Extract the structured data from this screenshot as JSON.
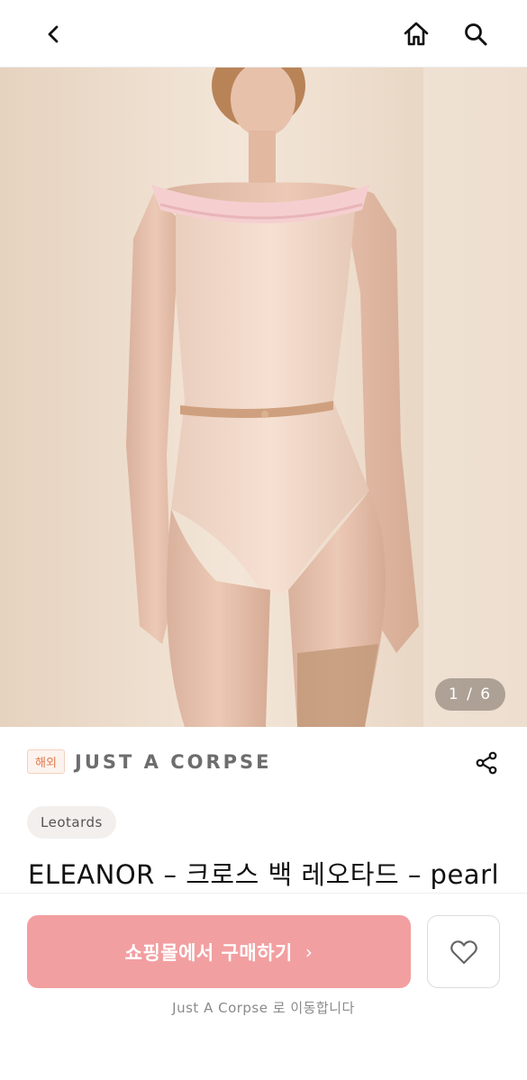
{
  "header": {
    "back_icon": "chevron-left-icon",
    "home_icon": "home-icon",
    "search_icon": "search-icon"
  },
  "gallery": {
    "counter": "1 / 6",
    "current": 1,
    "total": 6
  },
  "brand": {
    "badge": "해외",
    "name": "JUST A CORPSE",
    "share_icon": "share-icon"
  },
  "product": {
    "category": "Leotards",
    "title": "ELEANOR – 크로스 백 레오타드 – pearl"
  },
  "actions": {
    "buy_label": "쇼핑몰에서 구매하기",
    "buy_chevron": "›",
    "wish_icon": "heart-icon",
    "redirect_note": "Just A Corpse 로 이동합니다"
  },
  "colors": {
    "buy_button": "#f29fa1",
    "badge_text": "#e2784a",
    "brand_text": "#6d6d6d"
  }
}
